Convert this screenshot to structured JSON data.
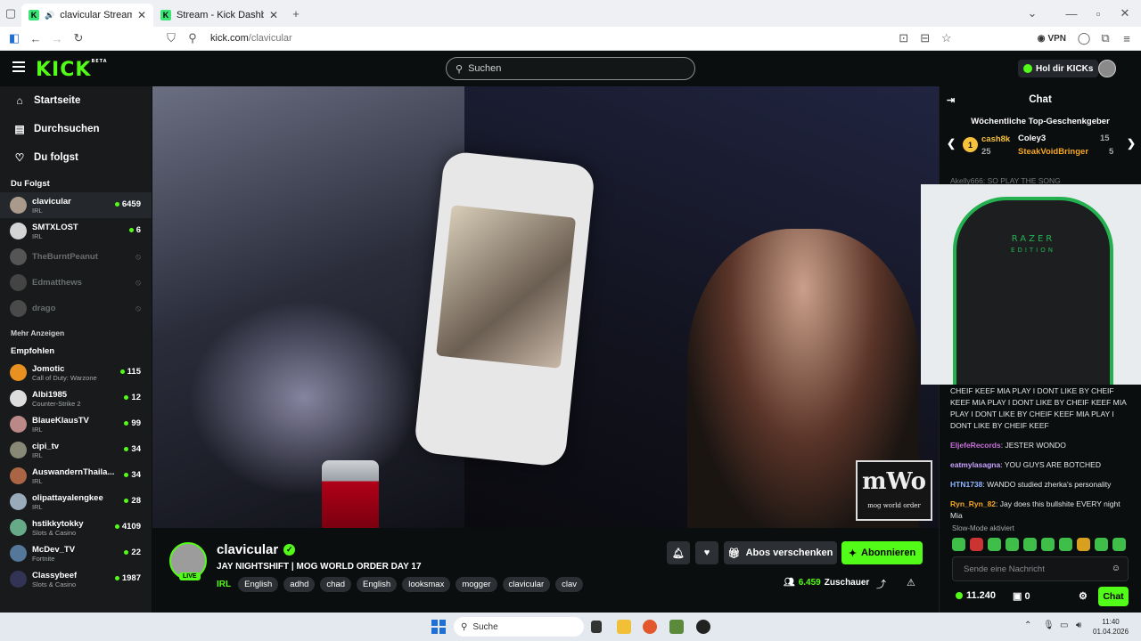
{
  "browser": {
    "tabs": [
      {
        "label": "clavicular Stream - Watch L",
        "active": true
      },
      {
        "label": "Stream - Kick Dashboard",
        "active": false
      }
    ],
    "new_tab": "+",
    "url_domain": "kick.com",
    "url_path": "/clavicular",
    "vpn_label": "VPN"
  },
  "header": {
    "logo": "KICK",
    "logo_badge": "BETA",
    "search_placeholder": "Suchen",
    "get_kicks": "Hol dir KICKs"
  },
  "sidebar": {
    "nav": [
      {
        "label": "Startseite",
        "icon": "home-icon"
      },
      {
        "label": "Durchsuchen",
        "icon": "browse-icon"
      },
      {
        "label": "Du folgst",
        "icon": "heart-icon"
      }
    ],
    "following_title": "Du Folgst",
    "following": [
      {
        "name": "clavicular",
        "category": "IRL",
        "viewers": "6459",
        "live": true
      },
      {
        "name": "SMTXLOST",
        "category": "IRL",
        "viewers": "6",
        "live": true
      },
      {
        "name": "TheBurntPeanut",
        "category": "",
        "viewers": "",
        "live": false
      },
      {
        "name": "Edmatthews",
        "category": "",
        "viewers": "",
        "live": false
      },
      {
        "name": "drago",
        "category": "",
        "viewers": "",
        "live": false
      }
    ],
    "show_more": "Mehr Anzeigen",
    "recommended_title": "Empfohlen",
    "recommended": [
      {
        "name": "Jomotic",
        "category": "Call of Duty: Warzone",
        "viewers": "115"
      },
      {
        "name": "Albi1985",
        "category": "Counter-Strike 2",
        "viewers": "12"
      },
      {
        "name": "BlaueKlausTV",
        "category": "IRL",
        "viewers": "99"
      },
      {
        "name": "cipi_tv",
        "category": "IRL",
        "viewers": "34"
      },
      {
        "name": "AuswandernThaila...",
        "category": "IRL",
        "viewers": "34"
      },
      {
        "name": "olipattayalengkee",
        "category": "IRL",
        "viewers": "28"
      },
      {
        "name": "hstikkytokky",
        "category": "Slots & Casino",
        "viewers": "4109"
      },
      {
        "name": "McDev_TV",
        "category": "Fortnite",
        "viewers": "22"
      },
      {
        "name": "Classybeef",
        "category": "Slots & Casino",
        "viewers": "1987"
      }
    ]
  },
  "video": {
    "watermark_big": "mWo",
    "watermark_small": "mog world order"
  },
  "stream": {
    "name": "clavicular",
    "live_badge": "LIVE",
    "title": "JAY NIGHTSHIFT | MOG WORLD ORDER DAY 17",
    "category": "IRL",
    "tags": [
      "English",
      "adhd",
      "chad",
      "English",
      "looksmax",
      "mogger",
      "clavicular",
      "clav"
    ],
    "gift_subs": "Abos verschenken",
    "subscribe": "Abonnieren",
    "viewers": "6.459",
    "viewers_label": "Zuschauer"
  },
  "chat": {
    "title": "Chat",
    "gifters_title": "Wöchentliche Top-Geschenkgeber",
    "gifters": [
      {
        "rank": "1",
        "name": "cash8k",
        "count": "25"
      },
      {
        "name": "Coley3",
        "count": "15"
      },
      {
        "name": "SteakVoidBringer",
        "count": "5"
      }
    ],
    "partial_line": "Akelly666: SO PLAY THE SONG",
    "messages": [
      {
        "user": "",
        "text": "CHEIF KEEF MIA PLAY I DONT LIKE BY CHEIF KEEF MIA PLAY I DONT LIKE BY CHEIF KEEF MIA PLAY I DONT LIKE BY CHEIF KEEF MIA PLAY I DONT LIKE BY CHEIF KEEF",
        "color": "#e6e6e6"
      },
      {
        "user": "EljefeRecords",
        "text": "JESTER WONDO",
        "color": "#c770d8"
      },
      {
        "user": "eatmylasagna",
        "text": "YOU GUYS ARE BOTCHED",
        "color": "#c9a2ff"
      },
      {
        "user": "HTN1738",
        "text": "WANDO studied zherka's personality",
        "color": "#8fb4ff"
      },
      {
        "user": "Ryn_Ryn_82",
        "text": "Jay does this bullshite EVERY night Mia",
        "color": "#f5a623"
      }
    ],
    "slow_mode": "Slow-Mode aktiviert",
    "input_placeholder": "Sende eine Nachricht",
    "kicks": "11.240",
    "chest_count": "0",
    "send": "Chat"
  },
  "cam": {
    "brand": "RAZER",
    "edition": "EDITION"
  },
  "taskbar": {
    "search": "Suche",
    "time": "11:40",
    "date": "01.04.2026"
  },
  "colors": {
    "accent": "#53fc18",
    "bg": "#0b0e0f",
    "sidebar": "#181a1b"
  }
}
